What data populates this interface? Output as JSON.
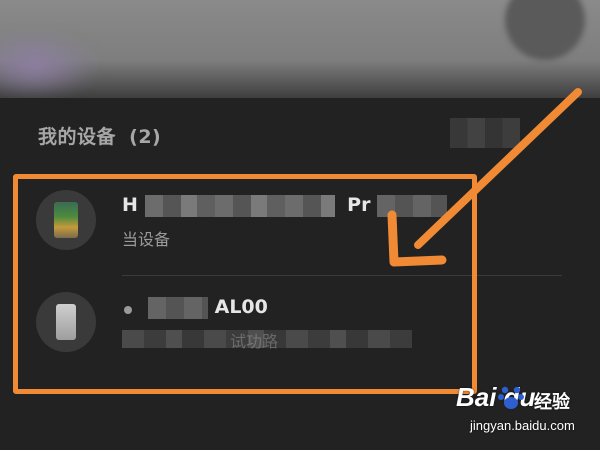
{
  "section": {
    "title": "我的设备",
    "count": "(2)"
  },
  "devices": [
    {
      "name_visible_prefix": "H",
      "name_visible_suffix": "Pr",
      "subtitle": "当设备"
    },
    {
      "name_visible_suffix": "AL00",
      "subtitle": "试功路"
    }
  ],
  "annotation": {
    "box_color": "#f08a35",
    "arrow_color": "#f08a35"
  },
  "watermark": {
    "logo": "Bai du",
    "label": "经验",
    "url": "jingyan.baidu.com"
  }
}
